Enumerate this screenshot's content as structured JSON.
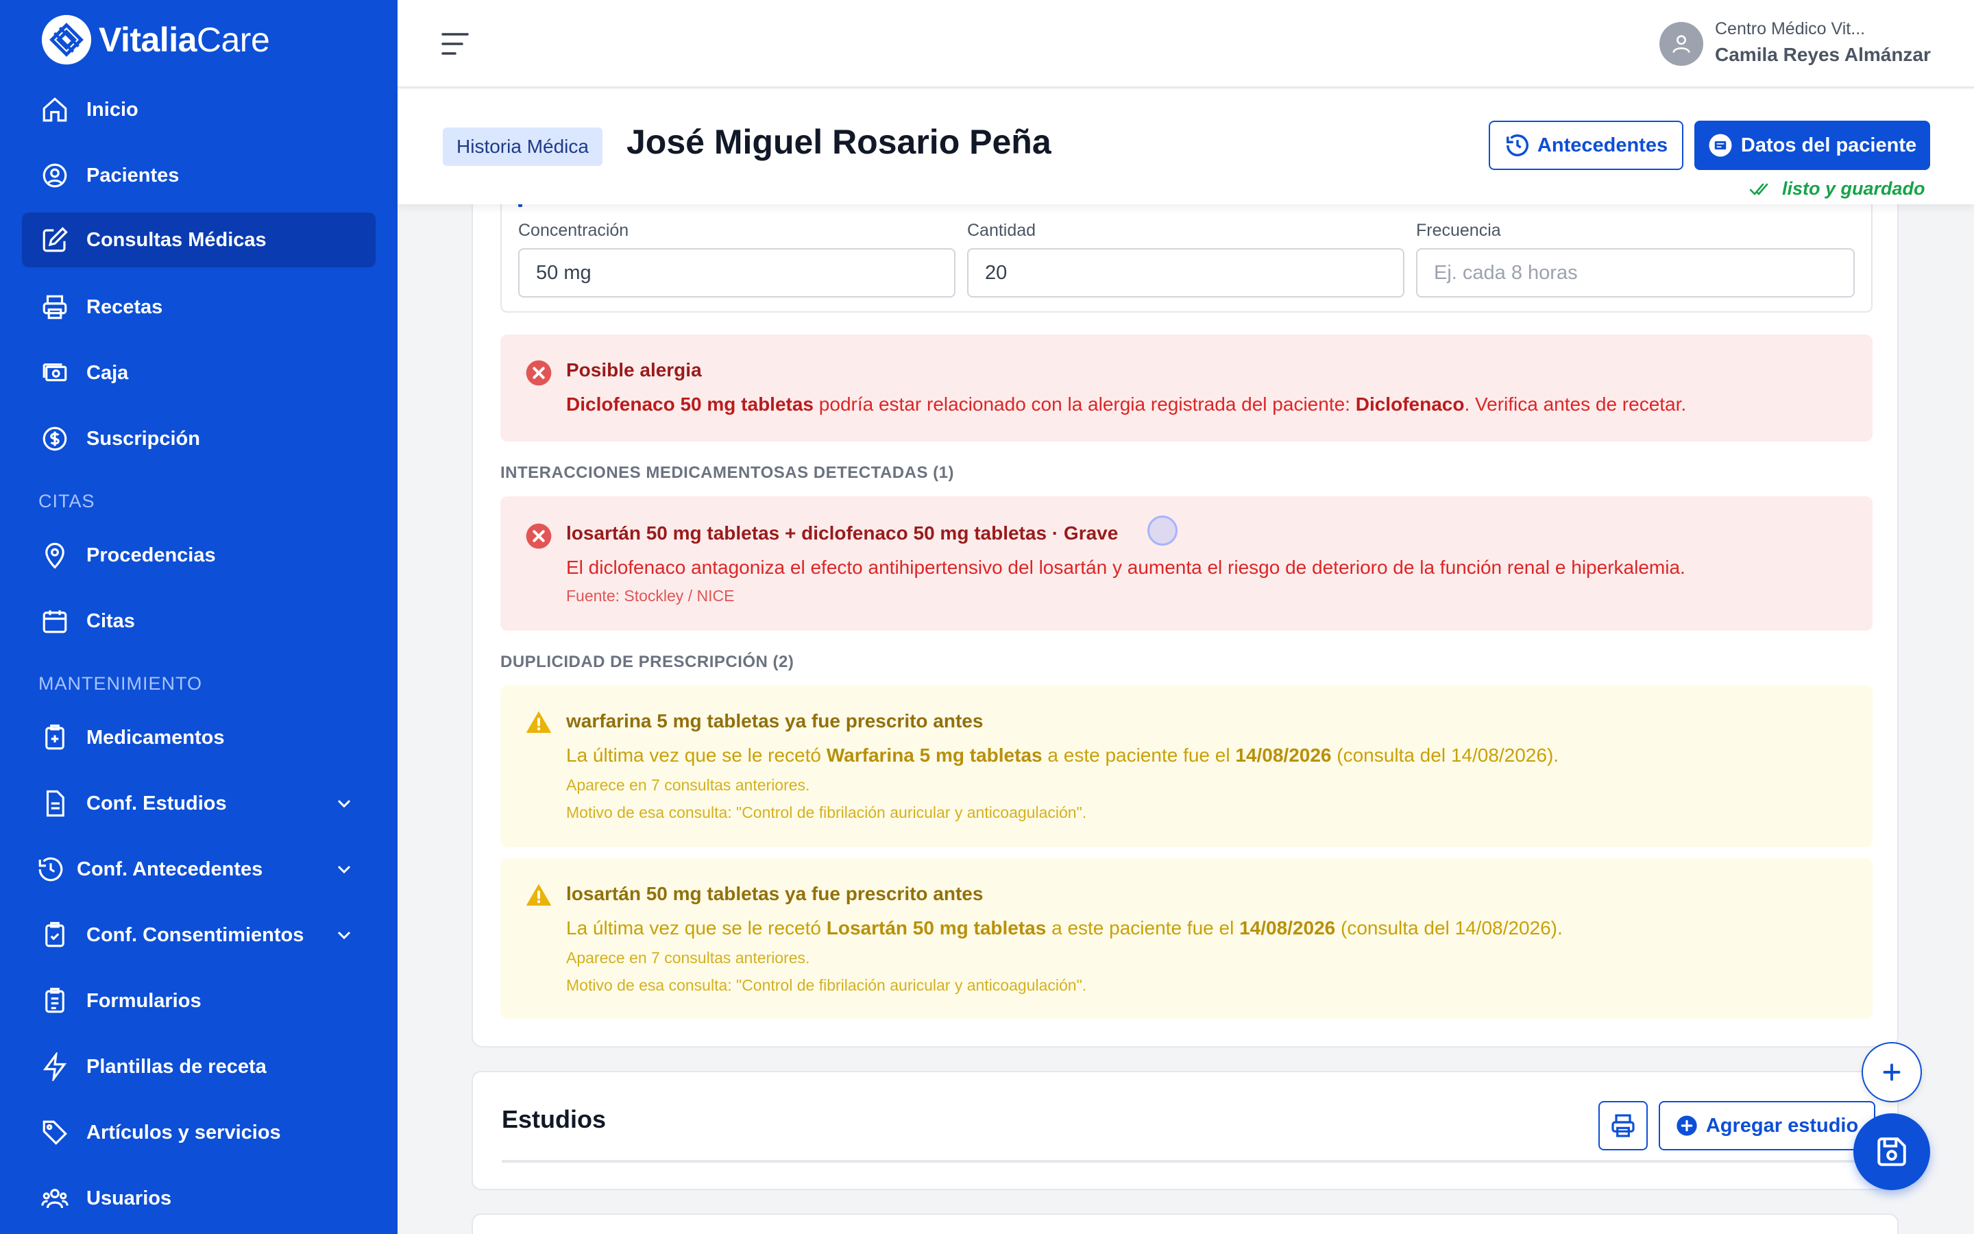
{
  "app": {
    "brand_bold": "Vitalia",
    "brand_light": "Care"
  },
  "sidebar": {
    "items": [
      {
        "label": "Inicio",
        "icon": "home-icon"
      },
      {
        "label": "Pacientes",
        "icon": "user-circle-icon"
      },
      {
        "label": "Consultas Médicas",
        "icon": "edit-icon",
        "active": true
      },
      {
        "label": "Recetas",
        "icon": "printer-icon"
      },
      {
        "label": "Caja",
        "icon": "cash-icon"
      },
      {
        "label": "Suscripción",
        "icon": "dollar-circle-icon"
      }
    ],
    "section_citas": "CITAS",
    "citas_items": [
      {
        "label": "Procedencias",
        "icon": "map-pin-icon"
      },
      {
        "label": "Citas",
        "icon": "calendar-icon"
      }
    ],
    "section_mantenimiento": "MANTENIMIENTO",
    "mant_items": [
      {
        "label": "Medicamentos",
        "icon": "medicine-icon"
      },
      {
        "label": "Conf. Estudios",
        "icon": "document-icon",
        "expandable": true
      },
      {
        "label": "Conf. Antecedentes",
        "icon": "history-icon",
        "expandable": true
      },
      {
        "label": "Conf. Consentimientos",
        "icon": "clipboard-check-icon",
        "expandable": true
      },
      {
        "label": "Formularios",
        "icon": "clipboard-list-icon"
      },
      {
        "label": "Plantillas de receta",
        "icon": "bolt-icon"
      },
      {
        "label": "Artículos y servicios",
        "icon": "tag-icon"
      },
      {
        "label": "Usuarios",
        "icon": "users-icon"
      }
    ]
  },
  "topbar": {
    "clinic": "Centro Médico Vit...",
    "user": "Camila Reyes Almánzar"
  },
  "patient": {
    "badge": "Historia Médica",
    "name": "José Miguel Rosario Peña",
    "btn_history": "Antecedentes",
    "btn_data": "Datos del paciente",
    "status": "listo y guardado"
  },
  "medication": {
    "concentration_label": "Concentración",
    "concentration_value": "50 mg",
    "quantity_label": "Cantidad",
    "quantity_value": "20",
    "frequency_label": "Frecuencia",
    "frequency_placeholder": "Ej. cada 8 horas"
  },
  "allergy_alert": {
    "title": "Posible alergia",
    "drug": "Diclofenaco 50 mg tabletas",
    "text_mid": " podría estar relacionado con la alergia registrada del paciente: ",
    "allergen": "Diclofenaco",
    "text_end": ". Verifica antes de recetar."
  },
  "interactions": {
    "heading": "INTERACCIONES MEDICAMENTOSAS DETECTADAS (1)",
    "items": [
      {
        "title": "losartán 50 mg tabletas + diclofenaco 50 mg tabletas · Grave",
        "body": "El diclofenaco antagoniza el efecto antihipertensivo del losartán y aumenta el riesgo de deterioro de la función renal e hiperkalemia.",
        "source": "Fuente: Stockley / NICE"
      }
    ]
  },
  "duplicates": {
    "heading": "DUPLICIDAD DE PRESCRIPCIÓN (2)",
    "items": [
      {
        "title": "warfarina 5 mg tabletas ya fue prescrito antes",
        "body_pre": "La última vez que se le recetó ",
        "drug": "Warfarina 5 mg tabletas",
        "body_mid": " a este paciente fue el ",
        "date": "14/08/2026",
        "body_end": " (consulta del 14/08/2026).",
        "count_text": "Aparece en 7 consultas anteriores.",
        "reason_text": "Motivo de esa consulta: \"Control de fibrilación auricular y anticoagulación\"."
      },
      {
        "title": "losartán 50 mg tabletas ya fue prescrito antes",
        "body_pre": "La última vez que se le recetó ",
        "drug": "Losartán 50 mg tabletas",
        "body_mid": " a este paciente fue el ",
        "date": "14/08/2026",
        "body_end": " (consulta del 14/08/2026).",
        "count_text": "Aparece en 7 consultas anteriores.",
        "reason_text": "Motivo de esa consulta: \"Control de fibrilación auricular y anticoagulación\"."
      }
    ]
  },
  "studies": {
    "title": "Estudios",
    "add_label": "Agregar estudio"
  },
  "colors": {
    "primary": "#0d4fd6",
    "danger_bg": "#fdecec",
    "warning_bg": "#fefce8",
    "success": "#16a34a"
  }
}
